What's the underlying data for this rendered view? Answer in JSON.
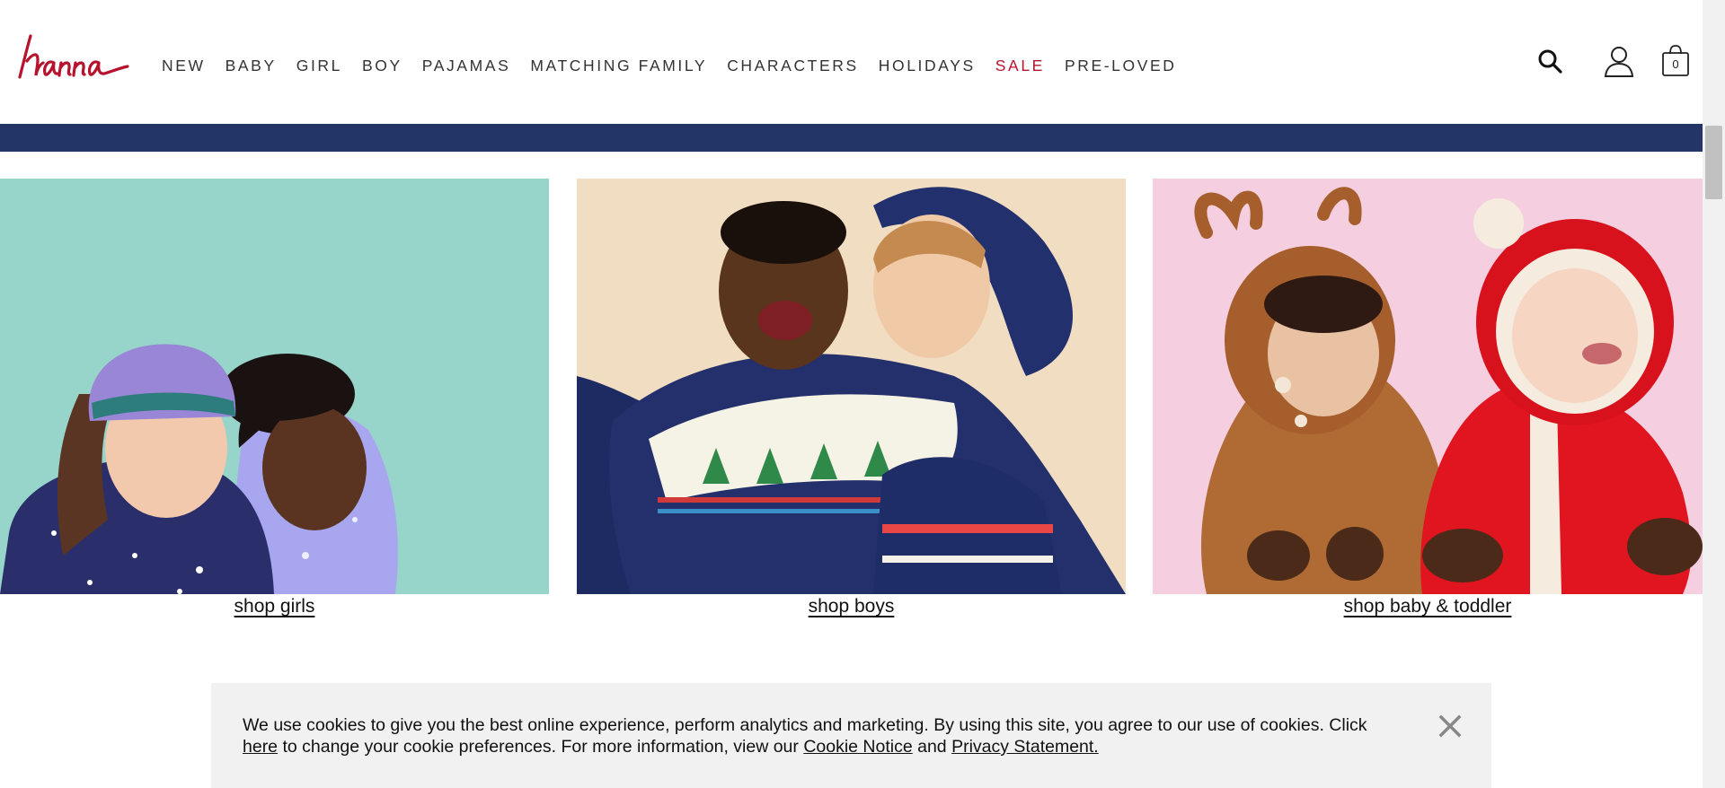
{
  "header": {
    "logo_text": "hanna",
    "nav": [
      {
        "label": "NEW",
        "key": "new"
      },
      {
        "label": "BABY",
        "key": "baby"
      },
      {
        "label": "GIRL",
        "key": "girl"
      },
      {
        "label": "BOY",
        "key": "boy"
      },
      {
        "label": "PAJAMAS",
        "key": "pajamas"
      },
      {
        "label": "MATCHING FAMILY",
        "key": "matching-family"
      },
      {
        "label": "CHARACTERS",
        "key": "characters"
      },
      {
        "label": "HOLIDAYS",
        "key": "holidays"
      },
      {
        "label": "SALE",
        "key": "sale"
      },
      {
        "label": "PRE-LOVED",
        "key": "pre-loved"
      }
    ],
    "icons": {
      "search": "search-icon",
      "account": "account-icon",
      "bag": "shopping-bag-icon"
    },
    "bag_count": "0"
  },
  "colors": {
    "brand_red": "#b6132e",
    "promo_band": "#233467",
    "cookie_bg": "#f1f1f1"
  },
  "tiles": [
    {
      "key": "girls",
      "link": "shop girls"
    },
    {
      "key": "boys",
      "link": "shop boys"
    },
    {
      "key": "baby",
      "link": "shop baby & toddler"
    }
  ],
  "cookie": {
    "text_before": "We use cookies to give you the best online experience, perform analytics and marketing. By using this site, you agree to our use of cookies. Click ",
    "here_link": "here",
    "text_middle": " to change your cookie preferences. For more information, view our ",
    "cookie_notice_link": "Cookie Notice",
    "and_text": " and ",
    "privacy_link": "Privacy Statement.",
    "close_icon": "close-icon"
  }
}
